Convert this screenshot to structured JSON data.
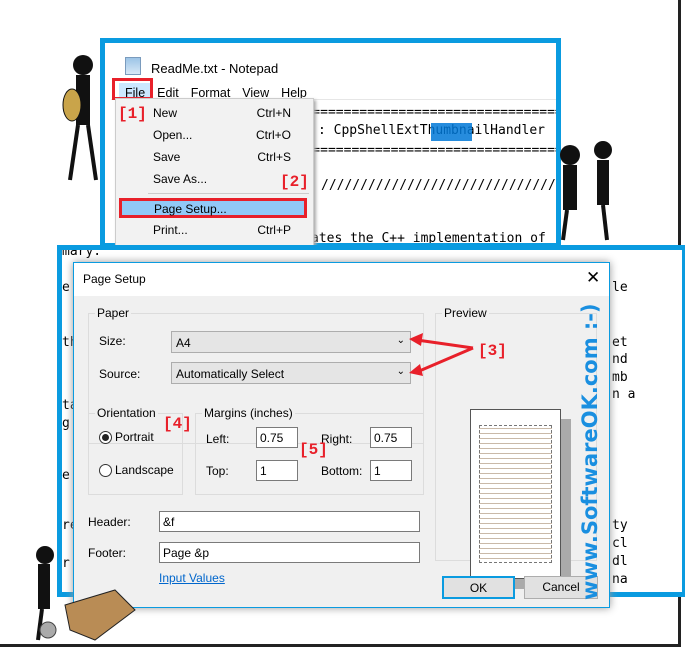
{
  "notepad": {
    "title": "ReadMe.txt - Notepad",
    "menu": [
      "File",
      "Edit",
      "Format",
      "View",
      "Help"
    ],
    "text_lines": [
      "===========================================",
      ": CppShellExtThumbnailHandler",
      "===========================================",
      "//////////////////////////////////////////",
      "ates the C++ implementation of"
    ],
    "highlight": "Thumb",
    "file_menu": [
      {
        "label": "New",
        "shortcut": "Ctrl+N"
      },
      {
        "label": "Open...",
        "shortcut": "Ctrl+O"
      },
      {
        "label": "Save",
        "shortcut": "Ctrl+S"
      },
      {
        "label": "Save As...",
        "shortcut": ""
      },
      {
        "label": "Page Setup...",
        "shortcut": ""
      },
      {
        "label": "Print...",
        "shortcut": "Ctrl+P"
      }
    ]
  },
  "background_text": [
    "mary.",
    "e",
    "th",
    "ta",
    "g",
    "la",
    "ep",
    "e",
    "e",
    "re",
    "s",
    "e",
    "r"
  ],
  "background_text_right": [
    "le",
    "et",
    "nd",
    "mb",
    "n a",
    "ty",
    "cl",
    "dl",
    "na"
  ],
  "dialog": {
    "title": "Page Setup",
    "paper_group": "Paper",
    "size_label": "Size:",
    "size_value": "A4",
    "source_label": "Source:",
    "source_value": "Automatically Select",
    "orientation_group": "Orientation",
    "portrait": "Portrait",
    "landscape": "Landscape",
    "orientation_selected": "Portrait",
    "margins_group": "Margins (inches)",
    "left_label": "Left:",
    "left_value": "0.75",
    "right_label": "Right:",
    "right_value": "0.75",
    "top_label": "Top:",
    "top_value": "1",
    "bottom_label": "Bottom:",
    "bottom_value": "1",
    "header_label": "Header:",
    "header_value": "&f",
    "footer_label": "Footer:",
    "footer_value": "Page &p",
    "input_values_link": "Input Values",
    "preview_group": "Preview",
    "ok": "OK",
    "cancel": "Cancel"
  },
  "annotations": [
    "[1]",
    "[2]",
    "[3]",
    "[4]",
    "[5]"
  ],
  "watermark": "www.SoftwareOK.com :-)",
  "colors": {
    "accent": "#0a9be0",
    "annotation": "#e8202a",
    "selection": "#0078d7",
    "menu_highlight": "#91c9f7"
  }
}
